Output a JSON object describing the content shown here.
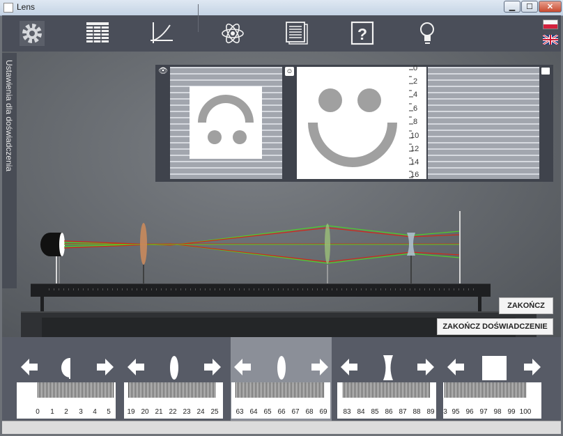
{
  "window": {
    "title": "Lens",
    "min_label": "▁",
    "max_label": "☐",
    "close_label": "✕"
  },
  "toolbar": {
    "items": [
      "settings-icon",
      "table-icon",
      "graph-icon",
      "atom-icon",
      "notes-icon",
      "help-icon",
      "bulb-icon"
    ]
  },
  "side_panel": {
    "label": "Ustawienia dla doświadczenia"
  },
  "screen_scale": {
    "labels": [
      "0",
      "2",
      "4",
      "6",
      "8",
      "10",
      "12",
      "14",
      "16"
    ]
  },
  "buttons": {
    "finish": "ZAKOŃCZ",
    "finish_experiment": "ZAKOŃCZ DOŚWIADCZENIE"
  },
  "rulers": [
    {
      "element": "light-source",
      "labels": [
        "0",
        "1",
        "2",
        "3",
        "4",
        "5"
      ]
    },
    {
      "element": "convex-lens-1",
      "labels": [
        "19",
        "20",
        "21",
        "22",
        "23",
        "24",
        "25"
      ]
    },
    {
      "element": "convex-lens-2",
      "labels": [
        "63",
        "64",
        "65",
        "66",
        "67",
        "68",
        "69"
      ]
    },
    {
      "element": "concave-lens",
      "labels": [
        "83",
        "84",
        "85",
        "86",
        "87",
        "88",
        "89"
      ]
    },
    {
      "element": "screen",
      "labels": [
        "3",
        "95",
        "96",
        "97",
        "98",
        "99",
        "100"
      ]
    }
  ],
  "colors": {
    "ray_red": "#d02a18",
    "ray_green": "#4fd02a",
    "toolbar": "#4a4e59",
    "highlight": "#8b8f98"
  }
}
